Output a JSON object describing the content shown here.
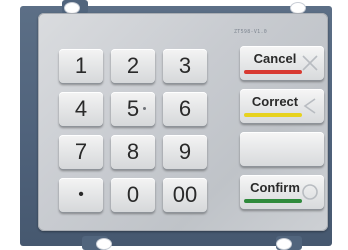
{
  "board": {
    "silkscreen": "ZT598-V1.0"
  },
  "keypad": {
    "numeric_keys": [
      {
        "label": "1"
      },
      {
        "label": "2"
      },
      {
        "label": "3"
      },
      {
        "label": "4"
      },
      {
        "label": "5"
      },
      {
        "label": "6"
      },
      {
        "label": "7"
      },
      {
        "label": "8"
      },
      {
        "label": "9"
      },
      {
        "label": "•"
      },
      {
        "label": "0"
      },
      {
        "label": "00"
      }
    ],
    "function_keys": {
      "cancel": {
        "label": "Cancel",
        "bar_color": "#d83a32",
        "icon": "x-icon"
      },
      "correct": {
        "label": "Correct",
        "bar_color": "#e7d21e",
        "icon": "chevron-left-icon"
      },
      "blank": {
        "label": ""
      },
      "confirm": {
        "label": "Confirm",
        "bar_color": "#2f8a3c",
        "icon": "circle-icon"
      }
    }
  }
}
